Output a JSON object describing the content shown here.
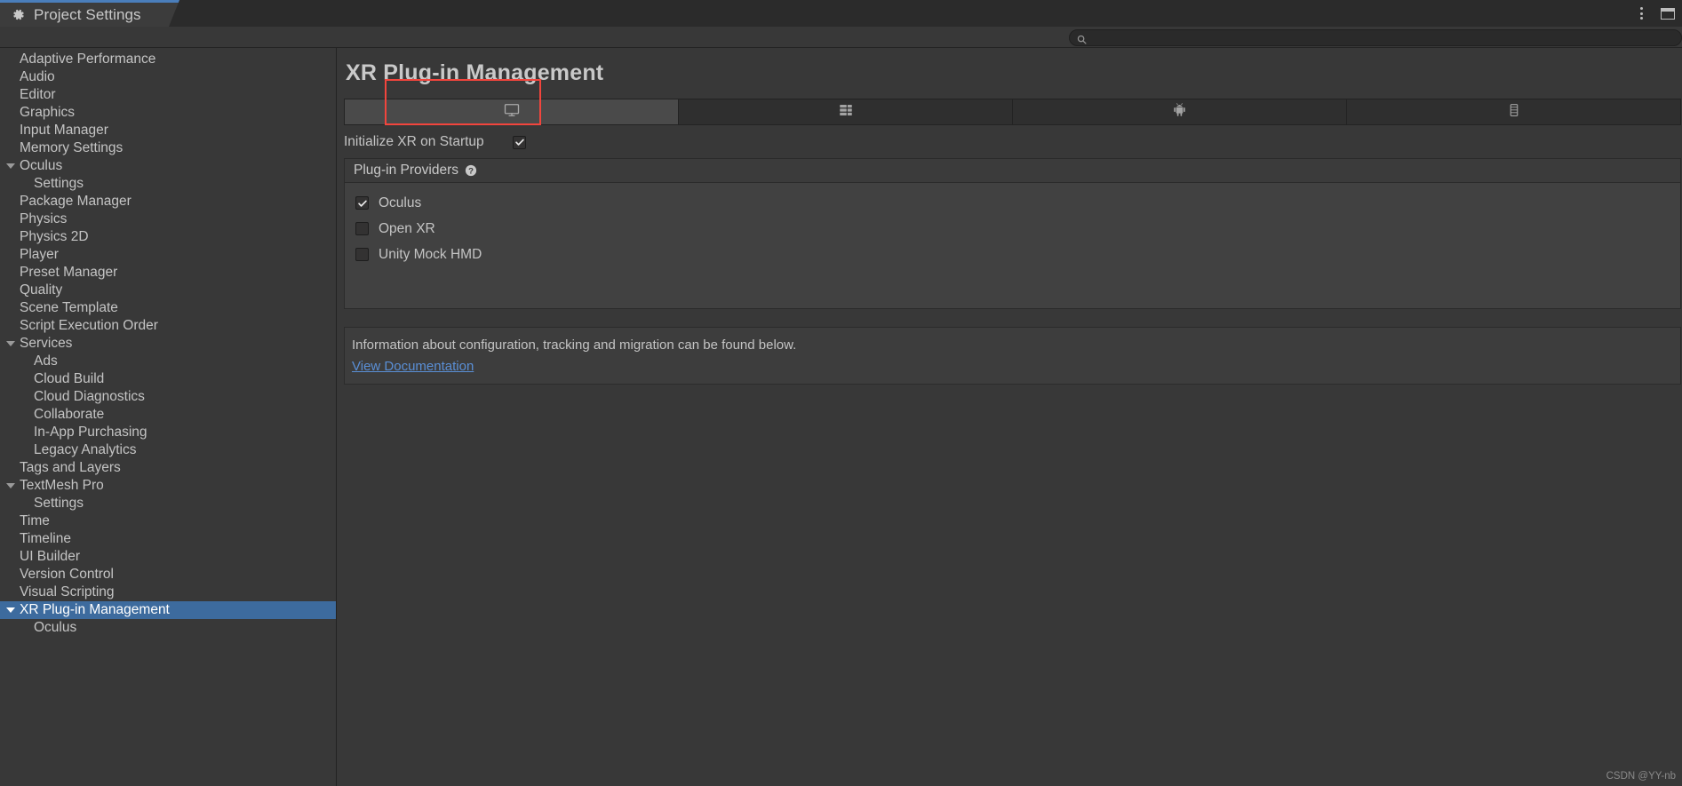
{
  "window": {
    "tab_label": "Project Settings",
    "gear_icon": "gear-icon",
    "menu_icon": "kebab-menu-icon",
    "maximize_icon": "maximize-window-icon"
  },
  "search": {
    "value": "",
    "placeholder": "",
    "icon": "search-icon"
  },
  "sidebar": {
    "items": [
      {
        "label": "Adaptive Performance",
        "level": 1,
        "expandable": false,
        "selected": false
      },
      {
        "label": "Audio",
        "level": 1,
        "expandable": false,
        "selected": false
      },
      {
        "label": "Editor",
        "level": 1,
        "expandable": false,
        "selected": false
      },
      {
        "label": "Graphics",
        "level": 1,
        "expandable": false,
        "selected": false
      },
      {
        "label": "Input Manager",
        "level": 1,
        "expandable": false,
        "selected": false
      },
      {
        "label": "Memory Settings",
        "level": 1,
        "expandable": false,
        "selected": false
      },
      {
        "label": "Oculus",
        "level": 1,
        "expandable": true,
        "selected": false
      },
      {
        "label": "Settings",
        "level": 2,
        "expandable": false,
        "selected": false
      },
      {
        "label": "Package Manager",
        "level": 1,
        "expandable": false,
        "selected": false
      },
      {
        "label": "Physics",
        "level": 1,
        "expandable": false,
        "selected": false
      },
      {
        "label": "Physics 2D",
        "level": 1,
        "expandable": false,
        "selected": false
      },
      {
        "label": "Player",
        "level": 1,
        "expandable": false,
        "selected": false
      },
      {
        "label": "Preset Manager",
        "level": 1,
        "expandable": false,
        "selected": false
      },
      {
        "label": "Quality",
        "level": 1,
        "expandable": false,
        "selected": false
      },
      {
        "label": "Scene Template",
        "level": 1,
        "expandable": false,
        "selected": false
      },
      {
        "label": "Script Execution Order",
        "level": 1,
        "expandable": false,
        "selected": false
      },
      {
        "label": "Services",
        "level": 1,
        "expandable": true,
        "selected": false
      },
      {
        "label": "Ads",
        "level": 2,
        "expandable": false,
        "selected": false
      },
      {
        "label": "Cloud Build",
        "level": 2,
        "expandable": false,
        "selected": false
      },
      {
        "label": "Cloud Diagnostics",
        "level": 2,
        "expandable": false,
        "selected": false
      },
      {
        "label": "Collaborate",
        "level": 2,
        "expandable": false,
        "selected": false
      },
      {
        "label": "In-App Purchasing",
        "level": 2,
        "expandable": false,
        "selected": false
      },
      {
        "label": "Legacy Analytics",
        "level": 2,
        "expandable": false,
        "selected": false
      },
      {
        "label": "Tags and Layers",
        "level": 1,
        "expandable": false,
        "selected": false
      },
      {
        "label": "TextMesh Pro",
        "level": 1,
        "expandable": true,
        "selected": false
      },
      {
        "label": "Settings",
        "level": 2,
        "expandable": false,
        "selected": false
      },
      {
        "label": "Time",
        "level": 1,
        "expandable": false,
        "selected": false
      },
      {
        "label": "Timeline",
        "level": 1,
        "expandable": false,
        "selected": false
      },
      {
        "label": "UI Builder",
        "level": 1,
        "expandable": false,
        "selected": false
      },
      {
        "label": "Version Control",
        "level": 1,
        "expandable": false,
        "selected": false
      },
      {
        "label": "Visual Scripting",
        "level": 1,
        "expandable": false,
        "selected": false
      },
      {
        "label": "XR Plug-in Management",
        "level": 1,
        "expandable": true,
        "selected": true
      },
      {
        "label": "Oculus",
        "level": 2,
        "expandable": false,
        "selected": false
      }
    ]
  },
  "main": {
    "title": "XR Plug-in Management",
    "platform_tabs": [
      {
        "name": "desktop",
        "icon": "monitor-icon",
        "active": true
      },
      {
        "name": "dedicated-server",
        "icon": "server-icon",
        "active": false
      },
      {
        "name": "android",
        "icon": "android-icon",
        "active": false
      },
      {
        "name": "universal-windows-platform",
        "icon": "uwp-icon",
        "active": false
      }
    ],
    "initialize_xr": {
      "label": "Initialize XR on Startup",
      "checked": true
    },
    "plugin_providers": {
      "header": "Plug-in Providers",
      "help_icon": "help-icon",
      "items": [
        {
          "label": "Oculus",
          "checked": true
        },
        {
          "label": "Open XR",
          "checked": false
        },
        {
          "label": "Unity Mock HMD",
          "checked": false
        }
      ]
    },
    "info": {
      "text": "Information about configuration, tracking and migration can be found below.",
      "link_label": "View Documentation"
    }
  },
  "watermark": "CSDN @YY-nb",
  "colors": {
    "selection": "#3d6b9e",
    "highlight_box": "#f2453d",
    "link": "#5a8fd6",
    "tab_accent": "#4a7ebb",
    "background": "#383838"
  }
}
